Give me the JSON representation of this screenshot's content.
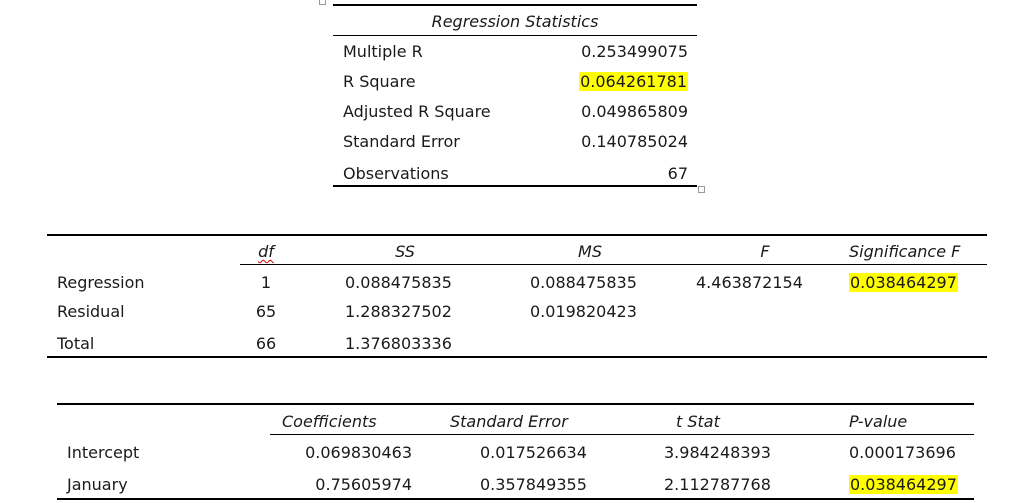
{
  "regression_statistics": {
    "title": "Regression Statistics",
    "rows": [
      {
        "label": "Multiple R",
        "value": "0.253499075"
      },
      {
        "label": "R Square",
        "value": "0.064261781"
      },
      {
        "label": "Adjusted R Square",
        "value": "0.049865809"
      },
      {
        "label": "Standard Error",
        "value": "0.140785024"
      },
      {
        "label": "Observations",
        "value": "67"
      }
    ],
    "highlight_color": "#ffff00"
  },
  "anova": {
    "headers": [
      "df",
      "SS",
      "MS",
      "F",
      "Significance F"
    ],
    "rows": [
      {
        "label": "Regression",
        "df": "1",
        "ss": "0.088475835",
        "ms": "0.088475835",
        "f": "4.463872154",
        "sig": "0.038464297"
      },
      {
        "label": "Residual",
        "df": "65",
        "ss": "1.288327502",
        "ms": "0.019820423",
        "f": "",
        "sig": ""
      },
      {
        "label": "Total",
        "df": "66",
        "ss": "1.376803336",
        "ms": "",
        "f": "",
        "sig": ""
      }
    ]
  },
  "coefficients": {
    "headers": [
      "Coefficients",
      "Standard Error",
      "t Stat",
      "P-value"
    ],
    "rows": [
      {
        "label": "Intercept",
        "coef": "0.069830463",
        "se": "0.017526634",
        "t": "3.984248393",
        "p": "0.000173696"
      },
      {
        "label": "January",
        "coef": "0.75605974",
        "se": "0.357849355",
        "t": "2.112787768",
        "p": "0.038464297"
      }
    ]
  }
}
